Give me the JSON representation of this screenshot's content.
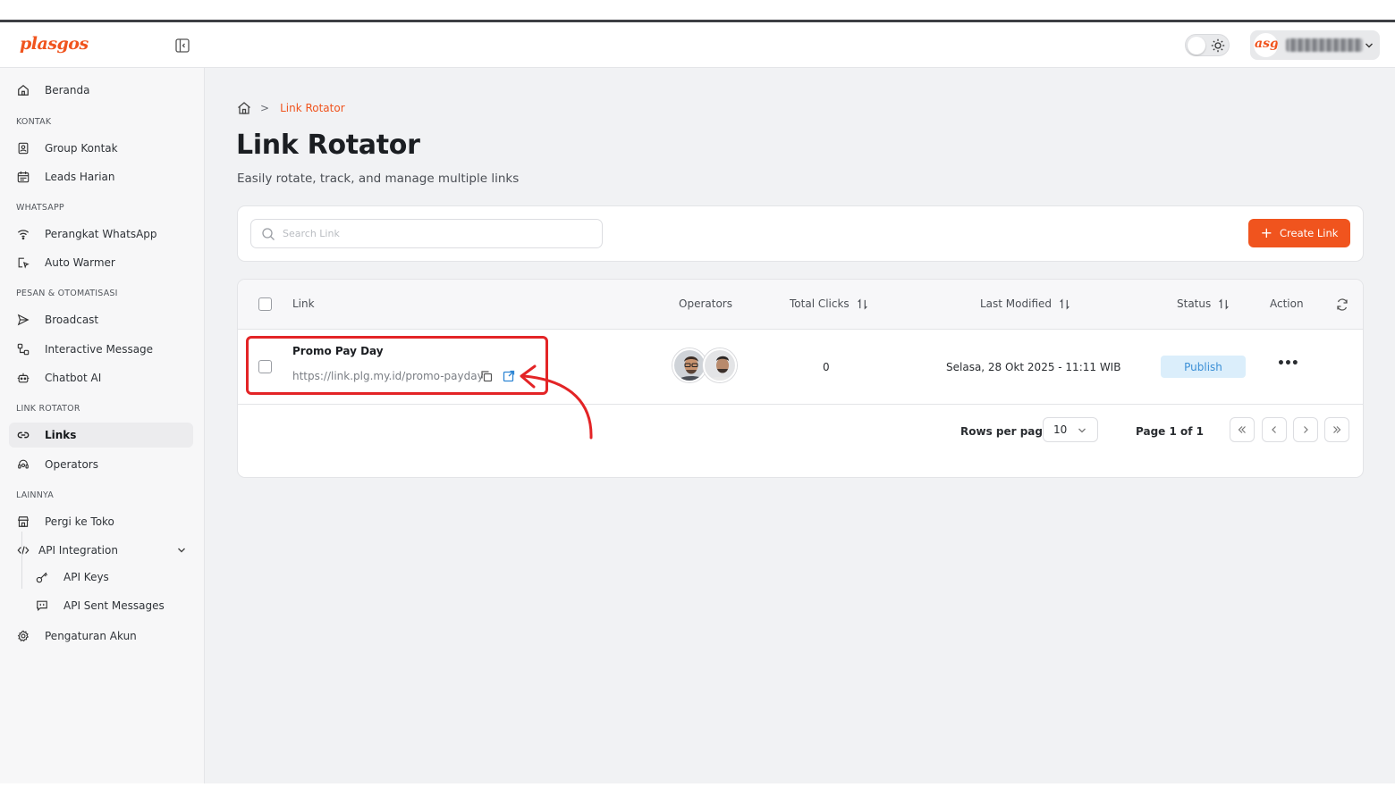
{
  "brand": {
    "logo_text": "plasgos",
    "accent_color": "#f0541e"
  },
  "sidebar": {
    "home": {
      "label": "Beranda",
      "icon": "home-icon"
    },
    "sections": [
      {
        "title": "KONTAK",
        "items": [
          {
            "label": "Group Kontak",
            "icon": "contact-book-icon"
          },
          {
            "label": "Leads Harian",
            "icon": "calendar-icon"
          }
        ]
      },
      {
        "title": "WHATSAPP",
        "items": [
          {
            "label": "Perangkat WhatsApp",
            "icon": "wifi-icon"
          },
          {
            "label": "Auto Warmer",
            "icon": "warmer-icon"
          }
        ]
      },
      {
        "title": "PESAN & OTOMATISASI",
        "items": [
          {
            "label": "Broadcast",
            "icon": "send-icon"
          },
          {
            "label": "Interactive Message",
            "icon": "flow-icon"
          },
          {
            "label": "Chatbot AI",
            "icon": "bot-icon"
          }
        ]
      },
      {
        "title": "LINK ROTATOR",
        "items": [
          {
            "label": "Links",
            "icon": "link-icon",
            "active": true
          },
          {
            "label": "Operators",
            "icon": "headset-icon"
          }
        ]
      },
      {
        "title": "LAINNYA",
        "items": [
          {
            "label": "Pergi ke Toko",
            "icon": "store-icon"
          },
          {
            "label": "API Integration",
            "icon": "code-icon"
          }
        ]
      }
    ],
    "api_sub": [
      {
        "label": "API Keys",
        "icon": "key-icon"
      },
      {
        "label": "API Sent Messages",
        "icon": "message-icon"
      }
    ],
    "settings": {
      "label": "Pengaturan Akun",
      "icon": "gear-icon"
    }
  },
  "header": {
    "theme": "light",
    "user_avatar_text": "asg"
  },
  "breadcrumb": {
    "current": "Link Rotator"
  },
  "page": {
    "title": "Link Rotator",
    "subtitle": "Easily rotate, track, and manage multiple links"
  },
  "toolbar": {
    "search_placeholder": "Search Link",
    "create_label": "Create Link"
  },
  "table": {
    "columns": {
      "link": "Link",
      "operators": "Operators",
      "total_clicks": "Total Clicks",
      "last_modified": "Last Modified",
      "status": "Status",
      "action": "Action"
    },
    "rows": [
      {
        "name": "Promo Pay Day",
        "url": "https://link.plg.my.id/promo-payday",
        "operators_count": 2,
        "total_clicks": "0",
        "last_modified": "Selasa, 28 Okt 2025 - 11:11 WIB",
        "status": "Publish",
        "status_color": "#3b8fd6"
      }
    ]
  },
  "pagination": {
    "rows_per_page_label": "Rows per page",
    "rows_per_page": "10",
    "page_info": "Page 1 of 1"
  },
  "annotation": {
    "highlight_color": "#e32426"
  }
}
